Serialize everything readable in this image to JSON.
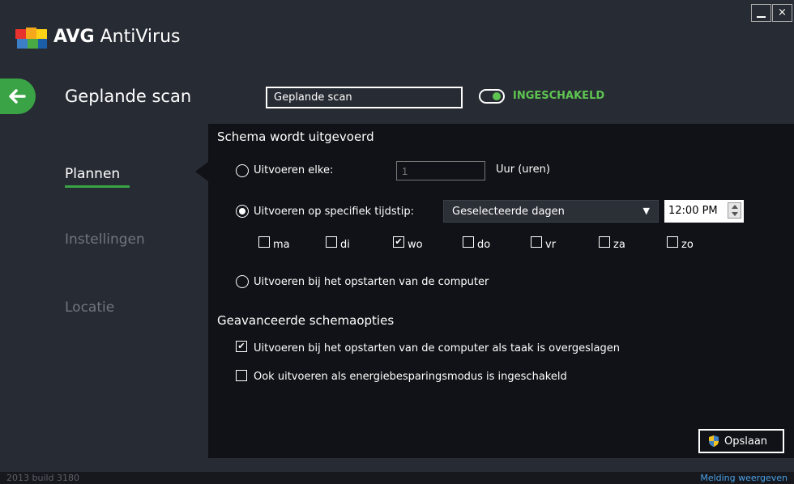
{
  "app": {
    "name_bold": "AVG",
    "name_rest": " AntiVirus"
  },
  "window": {
    "minimize": "_",
    "close": "×"
  },
  "header": {
    "title": "Geplande scan",
    "name_value": "Geplande scan",
    "toggle_label": "INGESCHAKELD"
  },
  "sidebar": {
    "items": [
      {
        "label": "Plannen"
      },
      {
        "label": "Instellingen"
      },
      {
        "label": "Locatie"
      }
    ]
  },
  "schedule": {
    "heading": "Schema wordt uitgevoerd",
    "every_label": "Uitvoeren elke:",
    "every_value": "1",
    "every_unit": "Uur (uren)",
    "specific_label": "Uitvoeren op specifiek tijdstip:",
    "specific_option": "Geselecteerde dagen",
    "time": "12:00 PM",
    "days": [
      {
        "label": "ma",
        "checked": false
      },
      {
        "label": "di",
        "checked": false
      },
      {
        "label": "wo",
        "checked": true
      },
      {
        "label": "do",
        "checked": false
      },
      {
        "label": "vr",
        "checked": false
      },
      {
        "label": "za",
        "checked": false
      },
      {
        "label": "zo",
        "checked": false
      }
    ],
    "startup_label": "Uitvoeren bij het opstarten van de computer"
  },
  "advanced": {
    "heading": "Geavanceerde schemaopties",
    "option1": "Uitvoeren bij het opstarten van de computer als taak is overgeslagen",
    "option2": "Ook uitvoeren als energiebesparingsmodus is ingeschakeld"
  },
  "save_label": "Opslaan",
  "status": {
    "build": "2013  build 3180",
    "notify": "Melding weergeven"
  },
  "colors": {
    "accent": "#3aa345",
    "toggle_green": "#5ec451",
    "link": "#4aa0e6"
  }
}
